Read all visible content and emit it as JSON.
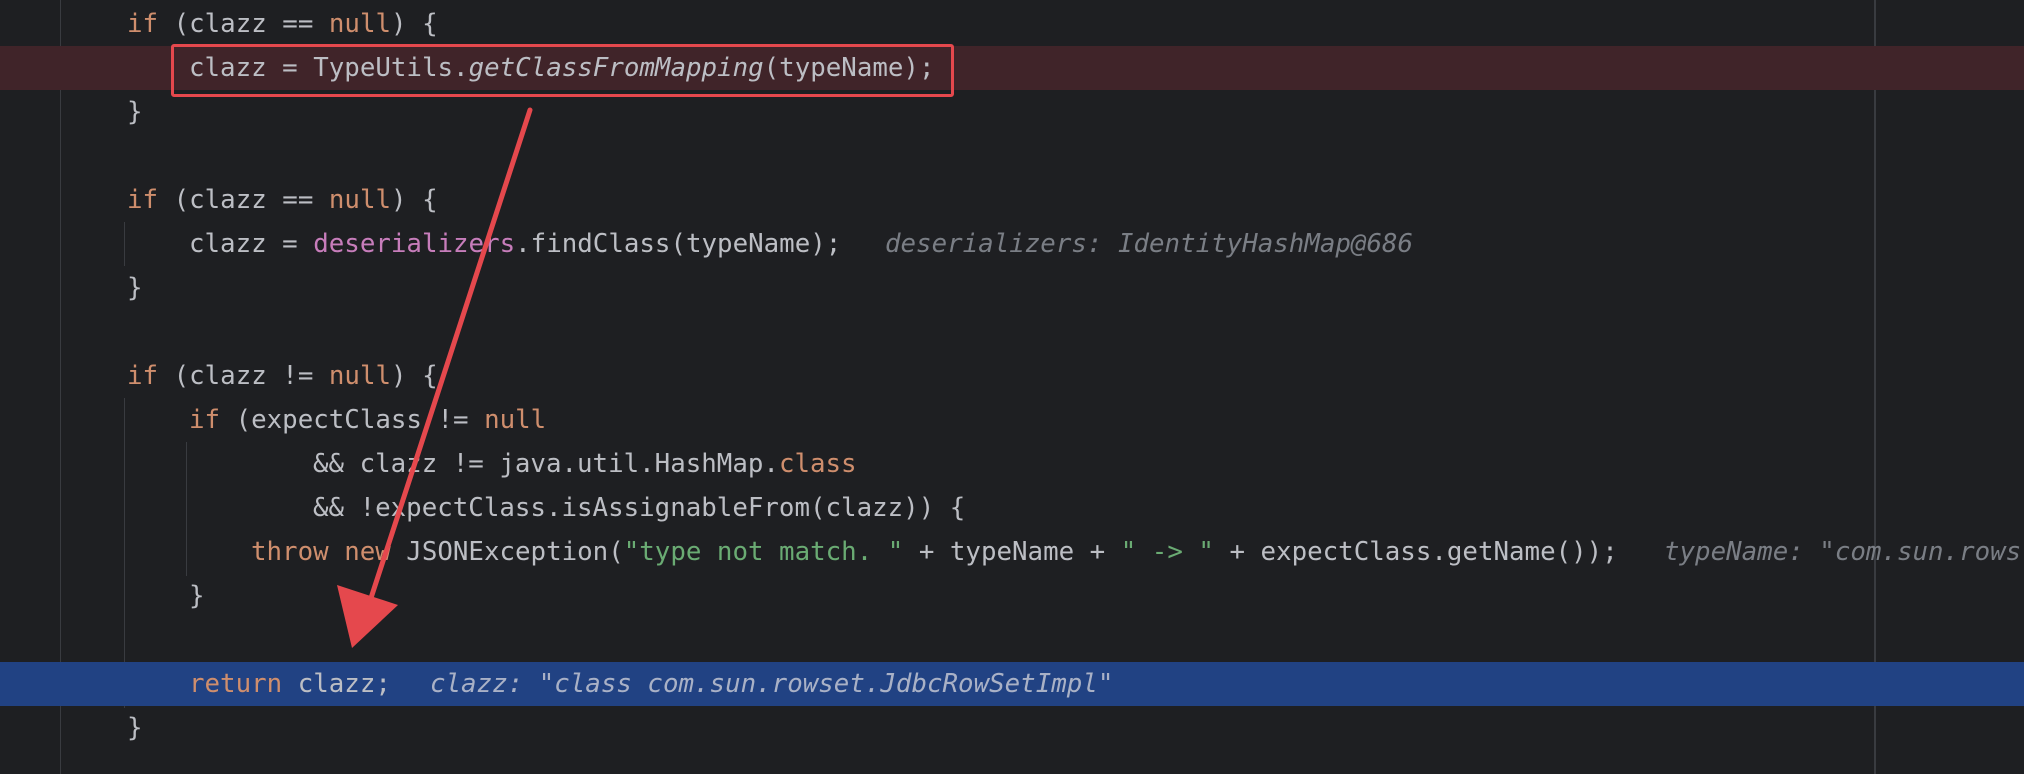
{
  "editor": {
    "lines": [
      {
        "id": "l1",
        "parts": [
          [
            "if",
            "kw"
          ],
          [
            " (clazz == ",
            ""
          ],
          [
            "null",
            "kw"
          ],
          [
            ") {",
            ""
          ]
        ]
      },
      {
        "id": "l2",
        "parts": [
          [
            "clazz = TypeUtils.",
            ""
          ],
          [
            "getClassFromMapping",
            "it"
          ],
          [
            "(typeName);",
            ""
          ]
        ]
      },
      {
        "id": "l3",
        "parts": [
          [
            "}",
            ""
          ]
        ]
      },
      {
        "id": "l5",
        "parts": [
          [
            "if",
            "kw"
          ],
          [
            " (clazz == ",
            ""
          ],
          [
            "null",
            "kw"
          ],
          [
            ") {",
            ""
          ]
        ]
      },
      {
        "id": "l6",
        "parts": [
          [
            "clazz = ",
            ""
          ],
          [
            "deserializers",
            "fld"
          ],
          [
            ".findClass(typeName);",
            ""
          ]
        ]
      },
      {
        "id": "l7",
        "parts": [
          [
            "}",
            ""
          ]
        ]
      },
      {
        "id": "l9",
        "parts": [
          [
            "if",
            "kw"
          ],
          [
            " (clazz != ",
            ""
          ],
          [
            "null",
            "kw"
          ],
          [
            ") {",
            ""
          ]
        ]
      },
      {
        "id": "l10",
        "parts": [
          [
            "if",
            "kw"
          ],
          [
            " (expectClass != ",
            ""
          ],
          [
            "null",
            "kw"
          ]
        ]
      },
      {
        "id": "l11",
        "parts": [
          [
            "&& clazz != java.util.HashMap.",
            ""
          ],
          [
            "class",
            "kw"
          ]
        ]
      },
      {
        "id": "l12",
        "parts": [
          [
            "&& !expectClass.isAssignableFrom(clazz)) {",
            ""
          ]
        ]
      },
      {
        "id": "l13",
        "parts": [
          [
            "throw",
            "kw"
          ],
          [
            " ",
            ""
          ],
          [
            "new",
            "kw"
          ],
          [
            " JSONException(",
            ""
          ],
          [
            "\"type not match. \"",
            "str"
          ],
          [
            " + typeName + ",
            ""
          ],
          [
            "\" -> \"",
            "str"
          ],
          [
            " + expectClass.getName());",
            ""
          ]
        ]
      },
      {
        "id": "l14",
        "parts": [
          [
            "}",
            ""
          ]
        ]
      },
      {
        "id": "l16",
        "parts": [
          [
            "return",
            "kw"
          ],
          [
            " clazz;",
            ""
          ]
        ]
      },
      {
        "id": "l17",
        "parts": [
          [
            "}",
            ""
          ]
        ]
      }
    ],
    "hints": {
      "l6": "deserializers: IdentityHashMap@686",
      "l13": "typeName: \"com.sun.rows",
      "l16": "clazz: \"class com.sun.rowset.JdbcRowSetImpl\""
    },
    "colors": {
      "background": "#1e1f22",
      "keyword": "#cf8e6d",
      "field": "#c77dbb",
      "string": "#6aab73",
      "hint": "#7a7e85",
      "error_line": "#402429",
      "current_line": "#214283",
      "annotation_red": "#e5484d"
    }
  }
}
